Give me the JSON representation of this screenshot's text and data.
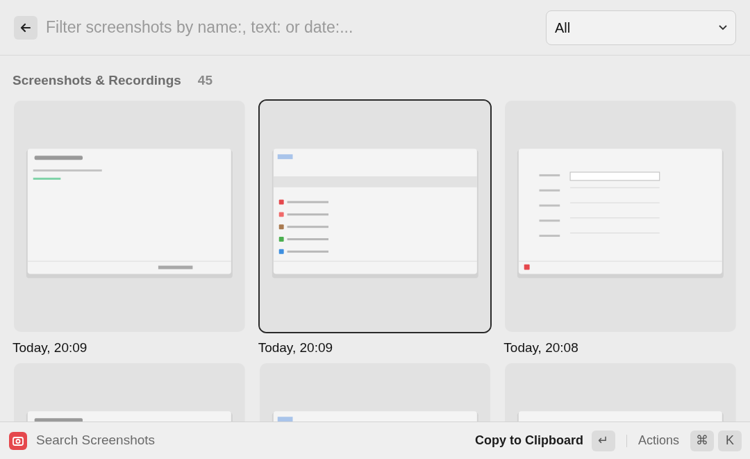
{
  "search": {
    "placeholder": "Filter screenshots by name:, text: or date:..."
  },
  "filter": {
    "value": "All"
  },
  "section": {
    "title": "Screenshots & Recordings",
    "count": "45"
  },
  "items": [
    {
      "caption": "Today, 20:09",
      "selected": false
    },
    {
      "caption": "Today, 20:09",
      "selected": true
    },
    {
      "caption": "Today, 20:08",
      "selected": false
    },
    {
      "selected": false
    },
    {
      "selected": false
    },
    {
      "selected": false
    }
  ],
  "footer": {
    "title": "Search Screenshots",
    "primary_action": "Copy to Clipboard",
    "primary_key": "↵",
    "actions": "Actions",
    "action_keys": [
      "⌘",
      "K"
    ]
  }
}
